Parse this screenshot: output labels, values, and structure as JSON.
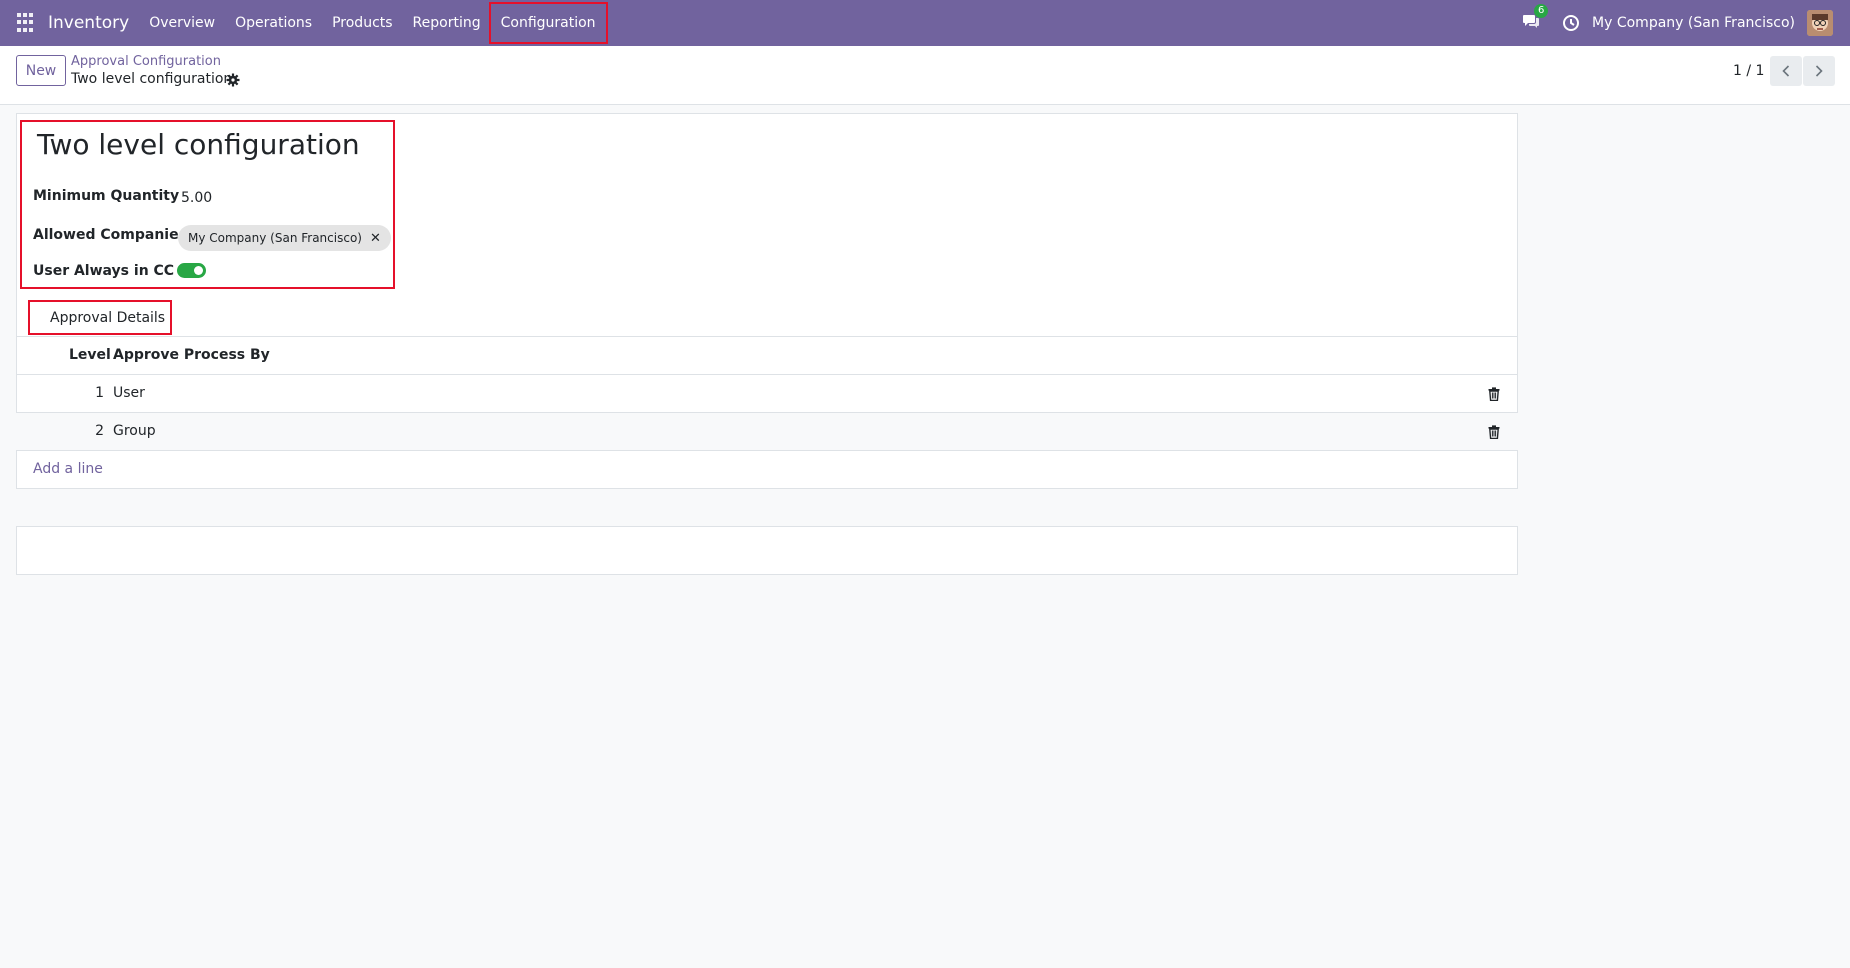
{
  "nav": {
    "brand": "Inventory",
    "menu": [
      "Overview",
      "Operations",
      "Products",
      "Reporting",
      "Configuration"
    ],
    "chat_count": "6",
    "company": "My Company (San Francisco)",
    "accent": "#71639e"
  },
  "control": {
    "new_label": "New",
    "breadcrumb_parent": "Approval Configuration",
    "breadcrumb_current": "Two level configuration",
    "pager": "1 / 1"
  },
  "form": {
    "title": "Two level configuration",
    "min_qty_label": "Minimum Quantity",
    "min_qty_value": "5.00",
    "companies_label": "Allowed Companies",
    "companies_tag": "My Company (San Francisco)",
    "cc_label": "User Always in CC",
    "cc_enabled": true
  },
  "tab": {
    "label": "Approval Details"
  },
  "table": {
    "headers": [
      "Level",
      "Approve Process By"
    ],
    "rows": [
      {
        "level": "1",
        "approve": "User"
      },
      {
        "level": "2",
        "approve": "Group"
      }
    ],
    "add_line": "Add a line"
  },
  "icons": [
    "apps-icon",
    "chat-icon",
    "clock-icon",
    "gear-icon",
    "chevron-left-icon",
    "chevron-right-icon",
    "trash-icon",
    "close-icon"
  ]
}
